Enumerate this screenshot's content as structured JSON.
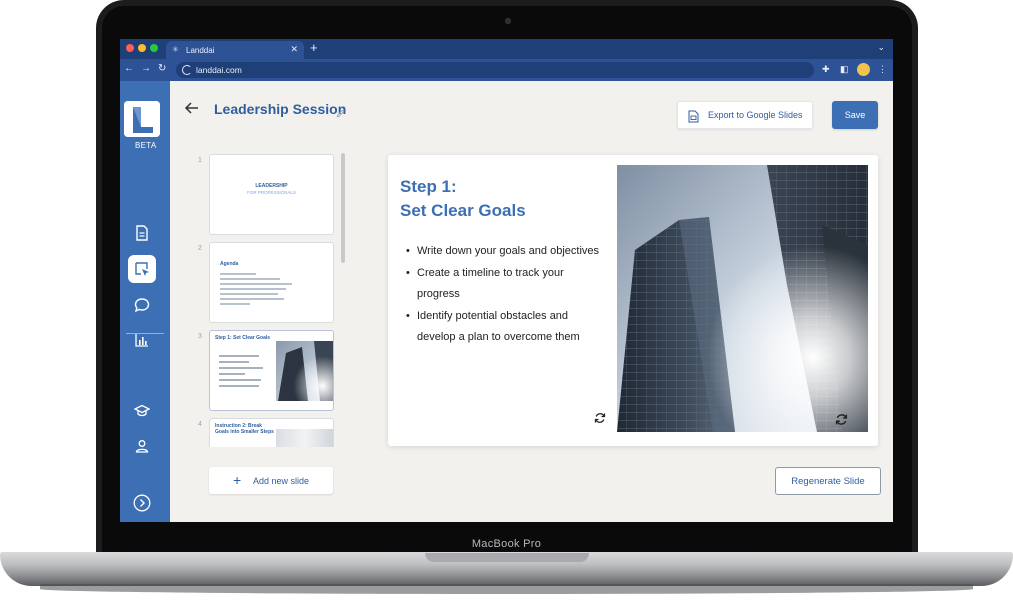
{
  "device": {
    "brand": "MacBook Pro"
  },
  "browser": {
    "tab_title": "Landdai",
    "url": "landdai.com",
    "traffic_light_colors": [
      "#ff5f57",
      "#febc2e",
      "#28c840"
    ],
    "chrome_color": "#1f3f78"
  },
  "sidebar": {
    "badge": "BETA",
    "items": [
      {
        "name": "document-icon"
      },
      {
        "name": "slides-pointer-icon",
        "active": true
      },
      {
        "name": "chat-icon"
      },
      {
        "name": "bar-chart-icon"
      },
      {
        "name": "graduation-cap-icon"
      },
      {
        "name": "user-icon"
      },
      {
        "name": "chevron-right-circle-icon"
      }
    ],
    "color": "#3c6fb3"
  },
  "header": {
    "title": "Leadership Session",
    "export_label": "Export to Google Slides",
    "save_label": "Save"
  },
  "thumbnails": [
    {
      "num": "1",
      "title": "LEADERSHIP",
      "subtitle": "FOR PROFESSIONALS"
    },
    {
      "num": "2",
      "title": "Agenda"
    },
    {
      "num": "3",
      "title": "Step 1: Set Clear Goals"
    },
    {
      "num": "4",
      "title": "Instruction 2: Break Goals into Smaller Steps"
    }
  ],
  "add_slide_label": "Add new slide",
  "slide": {
    "title_line1": "Step 1:",
    "title_line2": "Set Clear Goals",
    "bullets": [
      "Write down your goals and objectives",
      "Create a timeline to track your progress",
      "Identify potential obstacles and develop a plan to overcome them"
    ]
  },
  "regenerate_label": "Regenerate Slide",
  "accent_color": "#3c6fb3"
}
